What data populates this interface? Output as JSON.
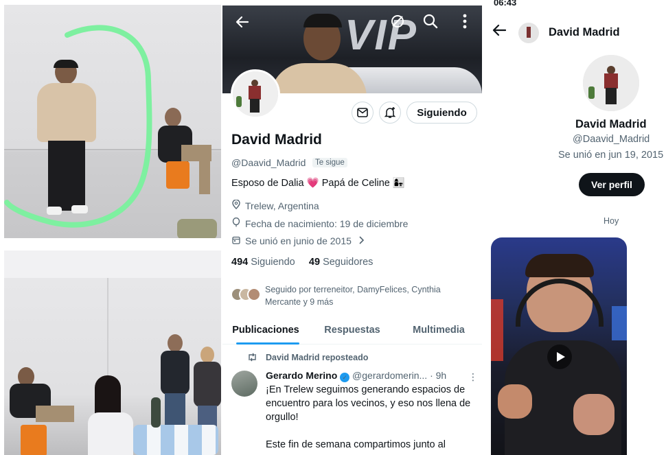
{
  "profile": {
    "name": "David Madrid",
    "handle": "@Daavid_Madrid",
    "follows_you": "Te sigue",
    "bio": "Esposo de Dalia 💗 Papá de Celine 👩‍👧",
    "location": "Trelew, Argentina",
    "birth": "Fecha de nacimiento: 19 de diciembre",
    "joined": "Se unió en junio de 2015",
    "following_count": "494",
    "following_label": "Siguiendo",
    "followers_count": "49",
    "followers_label": "Seguidores",
    "followed_by": "Seguido por terreneitor, DamyFelices, Cynthia Mercante y 9 más",
    "following_button": "Siguiendo",
    "banner_text": "VIP"
  },
  "tabs": [
    {
      "label": "Publicaciones",
      "active": true
    },
    {
      "label": "Respuestas",
      "active": false
    },
    {
      "label": "Multimedia",
      "active": false
    }
  ],
  "tweet": {
    "repost_label": "David Madrid reposteado",
    "author": "Gerardo Merino",
    "handle": "@gerardomerin...",
    "time": "· 9h",
    "body": "¡En Trelew seguimos generando espacios de encuentro para los vecinos, y eso nos llena de orgullo!\n\nEste fin de semana compartimos junto al"
  },
  "chat": {
    "status_time": "06:43",
    "header_name": "David Madrid",
    "name": "David Madrid",
    "handle": "@Daavid_Madrid",
    "joined": "Se unió en jun 19, 2015",
    "view_profile": "Ver perfil",
    "today": "Hoy"
  },
  "colors": {
    "accent": "#1d9bf0",
    "highlight": "#7ef0a0",
    "text": "#0f1419",
    "muted": "#536471"
  }
}
